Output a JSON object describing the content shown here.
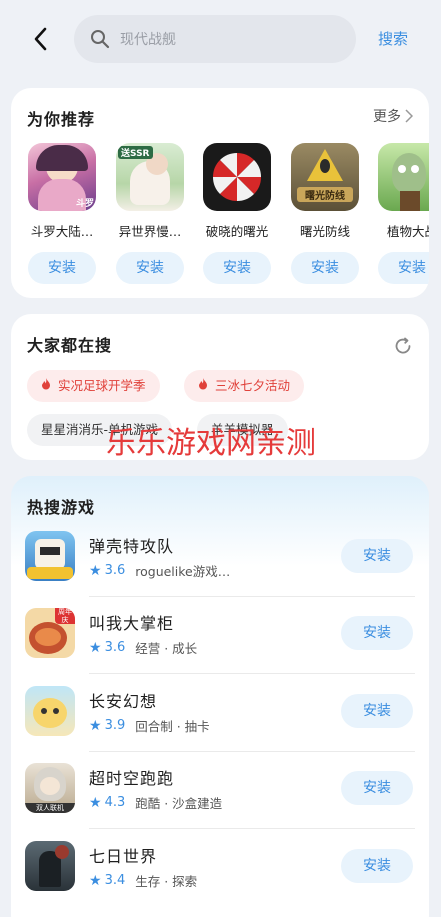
{
  "header": {
    "search_placeholder": "现代战舰",
    "search_button": "搜索"
  },
  "recommend": {
    "title": "为你推荐",
    "more": "更多",
    "apps": [
      {
        "name": "斗罗大陆…",
        "install": "安装",
        "badge": "斗罗"
      },
      {
        "name": "异世界慢…",
        "install": "安装",
        "badge": "送SSR"
      },
      {
        "name": "破晓的曙光",
        "install": "安装"
      },
      {
        "name": "曙光防线",
        "install": "安装",
        "badge": "曙光防线"
      },
      {
        "name": "植物大战",
        "install": "安装"
      }
    ]
  },
  "everyone_search": {
    "title": "大家都在搜",
    "chips": [
      {
        "label": "实况足球开学季",
        "hot": true
      },
      {
        "label": "三冰七夕活动",
        "hot": true
      },
      {
        "label": "星星消消乐-单机游戏",
        "hot": false
      },
      {
        "label": "羊羊模拟器",
        "hot": false
      }
    ]
  },
  "watermark": "乐乐游戏网亲测",
  "hot_games": {
    "title": "热搜游戏",
    "items": [
      {
        "name": "弹壳特攻队",
        "rating": "3.6",
        "tags": "roguelike游戏…",
        "install": "安装"
      },
      {
        "name": "叫我大掌柜",
        "rating": "3.6",
        "tags": "经营 · 成长",
        "install": "安装",
        "badge": "周年庆"
      },
      {
        "name": "长安幻想",
        "rating": "3.9",
        "tags": "回合制 · 抽卡",
        "install": "安装"
      },
      {
        "name": "超时空跑跑",
        "rating": "4.3",
        "tags": "跑酷 · 沙盒建造",
        "install": "安装",
        "badge": "双人联机"
      },
      {
        "name": "七日世界",
        "rating": "3.4",
        "tags": "生存 · 探索",
        "install": "安装"
      }
    ]
  },
  "colors": {
    "accent": "#3b8ee0",
    "hot_red": "#e0413a",
    "install_bg": "#e8f3fc"
  }
}
